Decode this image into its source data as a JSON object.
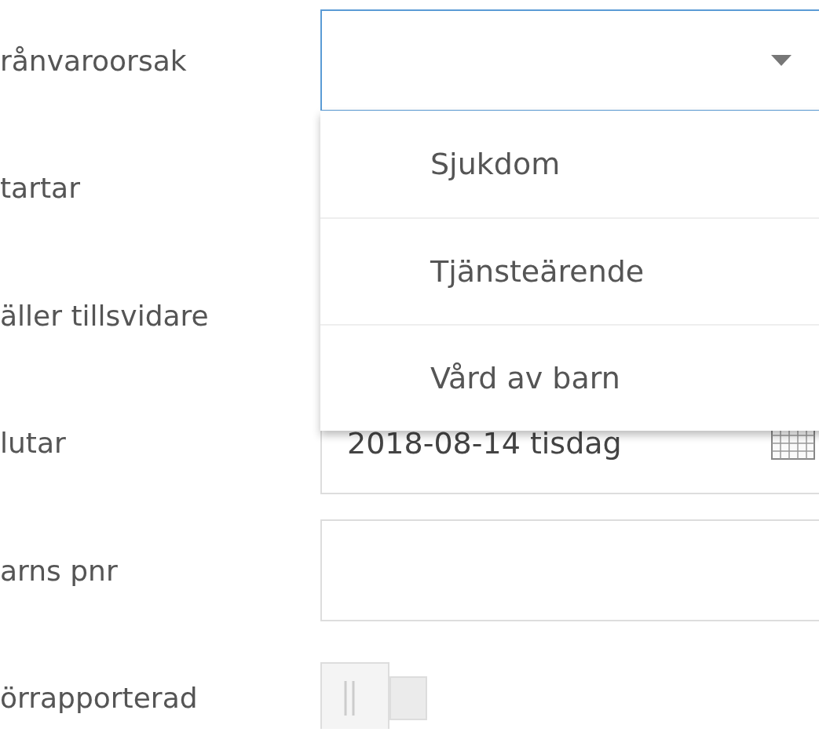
{
  "form": [
    {
      "label": "rånvaroorsak",
      "kind": "select",
      "expanded": true,
      "options": [
        {
          "label": "Sjukdom",
          "selected": false
        },
        {
          "label": "Tjänsteärende",
          "selected": false
        },
        {
          "label": "Vård av barn",
          "selected": false
        }
      ]
    },
    {
      "label": "tartar",
      "kind": "covered"
    },
    {
      "label": "äller tillsvidare",
      "kind": "covered"
    },
    {
      "label": "lutar",
      "kind": "date",
      "value": "2018-08-14 tisdag"
    },
    {
      "label": "arns pnr",
      "kind": "text"
    },
    {
      "label": "örrapporterad",
      "kind": "toggle",
      "on": false
    }
  ]
}
